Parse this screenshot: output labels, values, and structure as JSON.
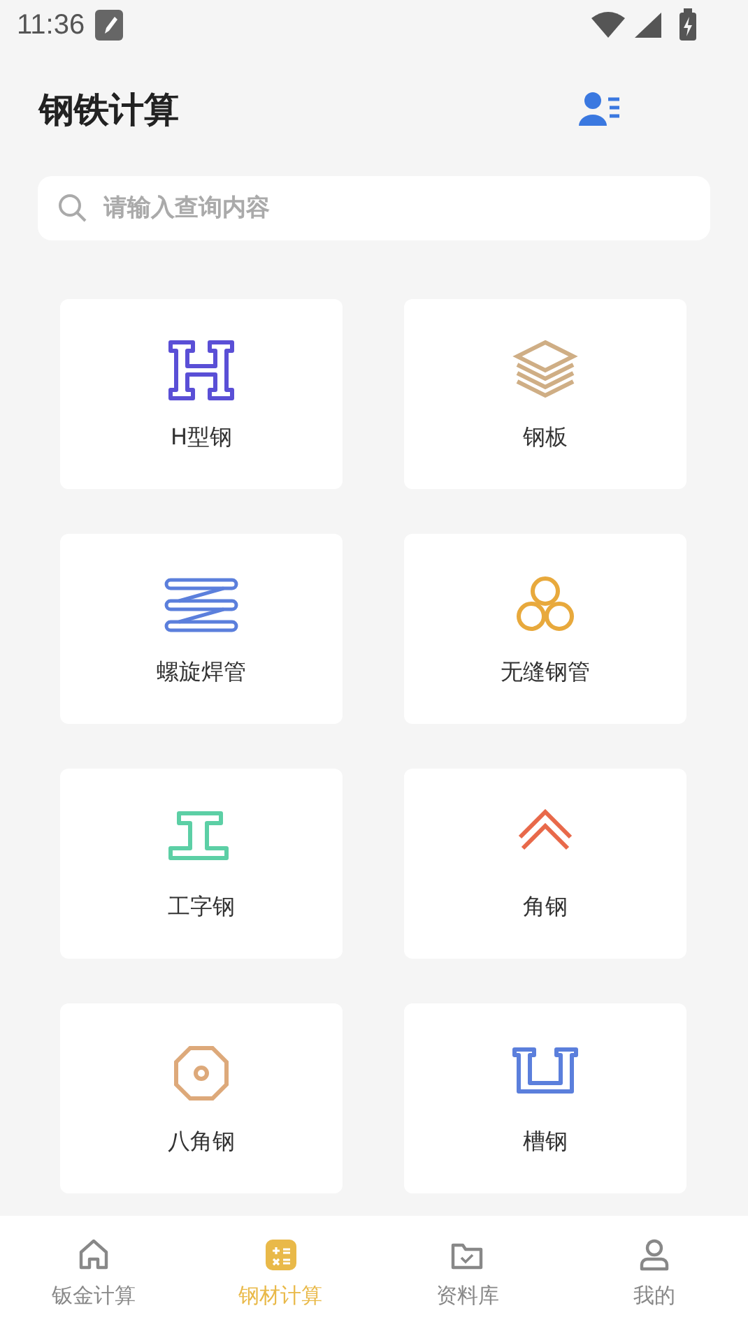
{
  "status_bar": {
    "time": "11:36"
  },
  "header": {
    "title": "钢铁计算"
  },
  "search": {
    "placeholder": "请输入查询内容"
  },
  "cards": [
    {
      "kind": "h-beam",
      "label": "H型钢"
    },
    {
      "kind": "plate",
      "label": "钢板"
    },
    {
      "kind": "spiral",
      "label": "螺旋焊管"
    },
    {
      "kind": "pipes",
      "label": "无缝钢管"
    },
    {
      "kind": "i-beam",
      "label": "工字钢"
    },
    {
      "kind": "angle",
      "label": "角钢"
    },
    {
      "kind": "octagon",
      "label": "八角钢"
    },
    {
      "kind": "channel",
      "label": "槽钢"
    }
  ],
  "tab_bar": [
    {
      "kind": "home",
      "label": "钣金计算",
      "selected": false
    },
    {
      "kind": "calculator",
      "label": "钢材计算",
      "selected": true
    },
    {
      "kind": "folder",
      "label": "资料库",
      "selected": false
    },
    {
      "kind": "person",
      "label": "我的",
      "selected": false
    }
  ]
}
